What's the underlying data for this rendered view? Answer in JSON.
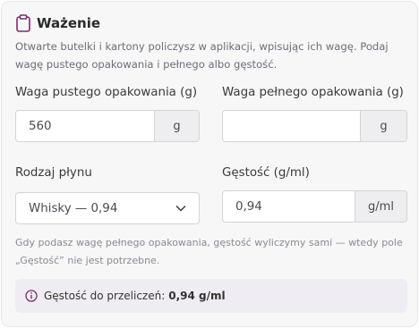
{
  "section": {
    "title": "Ważenie",
    "description": "Otwarte butelki i kartony policzysz w aplikacji, wpisując ich wagę. Podaj wagę pustego opakowania i pełnego albo gęstość."
  },
  "empty_weight": {
    "label": "Waga pustego opakowania (g)",
    "value": "560",
    "unit": "g"
  },
  "full_weight": {
    "label": "Waga pełnego opakowania (g)",
    "value": "",
    "unit": "g"
  },
  "liquid_type": {
    "label": "Rodzaj płynu",
    "selected": "Whisky — 0,94"
  },
  "density": {
    "label": "Gęstość (g/ml)",
    "value": "0,94",
    "unit": "g/ml"
  },
  "hint": "Gdy podasz wagę pełnego opakowania, gęstość wyliczymy sami — wtedy pole „Gęstość” nie jest potrzebne.",
  "info": {
    "label": "Gęstość do przeliczeń:",
    "value": "0,94 g/ml"
  },
  "colors": {
    "accent": "#7b2d6e",
    "card_bg": "#f7f7f8",
    "info_bg": "#efedf3"
  },
  "icons": {
    "section": "clipboard-icon",
    "select": "chevron-down-icon",
    "info": "info-icon"
  }
}
